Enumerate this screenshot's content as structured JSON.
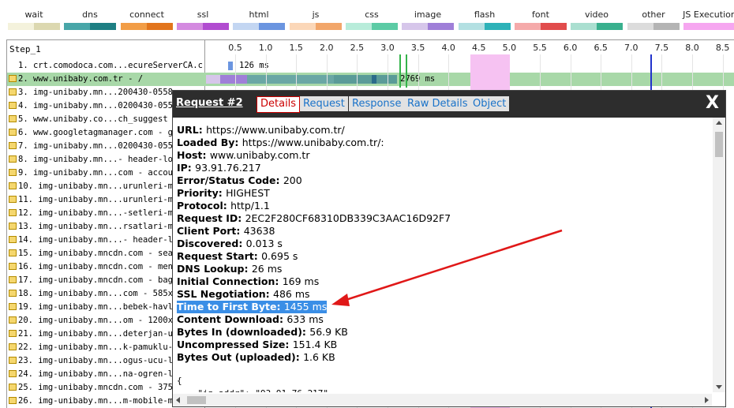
{
  "legend": [
    {
      "label": "wait",
      "colors": [
        "#f4f2dc",
        "#dcd8b0"
      ]
    },
    {
      "label": "dns",
      "colors": [
        "#48a6a8",
        "#1e7f83"
      ]
    },
    {
      "label": "connect",
      "colors": [
        "#f29d46",
        "#e2751c"
      ]
    },
    {
      "label": "ssl",
      "colors": [
        "#d48ae0",
        "#b14cd0"
      ]
    },
    {
      "label": "html",
      "colors": [
        "#c3d6f2",
        "#6b95e0"
      ]
    },
    {
      "label": "js",
      "colors": [
        "#fbd7b8",
        "#f2a66a"
      ]
    },
    {
      "label": "css",
      "colors": [
        "#b8ecda",
        "#5ccba5"
      ]
    },
    {
      "label": "image",
      "colors": [
        "#d6c6ea",
        "#9f7fd8"
      ]
    },
    {
      "label": "flash",
      "colors": [
        "#b3e0e2",
        "#2db2b8"
      ]
    },
    {
      "label": "font",
      "colors": [
        "#f5aaaa",
        "#e14c4c"
      ]
    },
    {
      "label": "video",
      "colors": [
        "#aadfd0",
        "#39b08e"
      ]
    },
    {
      "label": "other",
      "colors": [
        "#dcdcdc",
        "#b4b4b4"
      ]
    },
    {
      "label": "JS Execution",
      "colors": [
        "#f6a6f0",
        "#f6a6f0"
      ]
    }
  ],
  "waterfall": {
    "step_label": "Step_1",
    "ticks": [
      "0.5",
      "1.0",
      "1.5",
      "2.0",
      "2.5",
      "3.0",
      "3.5",
      "4.0",
      "4.5",
      "5.0",
      "5.5",
      "6.0",
      "6.5",
      "7.0",
      "7.5",
      "8.0",
      "8.5"
    ],
    "rows": [
      {
        "label": "1. crt.comodoca.com...ecureServerCA.crt",
        "secure": false,
        "highlight": false,
        "timing": "126 ms"
      },
      {
        "label": "2. www.unibaby.com.tr - /",
        "secure": true,
        "highlight": true,
        "timing": "2769 ms"
      },
      {
        "label": "3. img-unibaby.mn...200430-0558",
        "secure": true,
        "highlight": false,
        "timing": ""
      },
      {
        "label": "4. img-unibaby.mn...0200430-055",
        "secure": true,
        "highlight": false,
        "timing": ""
      },
      {
        "label": "5. www.unibaby.co...ch_suggest",
        "secure": true,
        "highlight": false,
        "timing": ""
      },
      {
        "label": "6. www.googletagmanager.com - g",
        "secure": true,
        "highlight": false,
        "timing": ""
      },
      {
        "label": "7. img-unibaby.mn...0200430-055",
        "secure": true,
        "highlight": false,
        "timing": ""
      },
      {
        "label": "8. img-unibaby.mn...- header-lo",
        "secure": true,
        "highlight": false,
        "timing": ""
      },
      {
        "label": "9. img-unibaby.mn...com - accou",
        "secure": true,
        "highlight": false,
        "timing": ""
      },
      {
        "label": "10. img-unibaby.mn...urunleri-me",
        "secure": true,
        "highlight": false,
        "timing": ""
      },
      {
        "label": "11. img-unibaby.mn...urunleri-me",
        "secure": true,
        "highlight": false,
        "timing": ""
      },
      {
        "label": "12. img-unibaby.mn...-setleri-me",
        "secure": true,
        "highlight": false,
        "timing": ""
      },
      {
        "label": "13. img-unibaby.mn...rsatlari-me",
        "secure": true,
        "highlight": false,
        "timing": ""
      },
      {
        "label": "14. img-unibaby.mn...- header-lo",
        "secure": true,
        "highlight": false,
        "timing": ""
      },
      {
        "label": "15. img-unibaby.mncdn.com - sear",
        "secure": true,
        "highlight": false,
        "timing": ""
      },
      {
        "label": "16. img-unibaby.mncdn.com - menu",
        "secure": true,
        "highlight": false,
        "timing": ""
      },
      {
        "label": "17. img-unibaby.mncdn.com - bag.",
        "secure": true,
        "highlight": false,
        "timing": ""
      },
      {
        "label": "18. img-unibaby.mn...com - 585x5",
        "secure": true,
        "highlight": false,
        "timing": ""
      },
      {
        "label": "19. img-unibaby.mn...bebek-havlu",
        "secure": true,
        "highlight": false,
        "timing": ""
      },
      {
        "label": "20. img-unibaby.mn...om - 1200x5",
        "secure": true,
        "highlight": false,
        "timing": ""
      },
      {
        "label": "21. img-unibaby.mn...deterjan-ur",
        "secure": true,
        "highlight": false,
        "timing": ""
      },
      {
        "label": "22. img-unibaby.mn...k-pamuklu-3",
        "secure": true,
        "highlight": false,
        "timing": ""
      },
      {
        "label": "23. img-unibaby.mn...ogus-ucu-li",
        "secure": true,
        "highlight": false,
        "timing": ""
      },
      {
        "label": "24. img-unibaby.mn...na-ogren-li",
        "secure": true,
        "highlight": false,
        "timing": ""
      },
      {
        "label": "25. img-unibaby.mncdn.com - 375x5",
        "secure": true,
        "highlight": false,
        "timing": ""
      },
      {
        "label": "26. img-unibaby.mn...m-mobile-me",
        "secure": true,
        "highlight": false,
        "timing": ""
      }
    ]
  },
  "dialog": {
    "title": "Request #2",
    "tabs": [
      "Details",
      "Request",
      "Response",
      "Raw Details",
      "Object"
    ],
    "active_tab": "Details",
    "close_label": "X",
    "fields": [
      {
        "key": "URL:",
        "value": "https://www.unibaby.com.tr/"
      },
      {
        "key": "Loaded By:",
        "value": "https://www.unibaby.com.tr/:"
      },
      {
        "key": "Host:",
        "value": "www.unibaby.com.tr"
      },
      {
        "key": "IP:",
        "value": "93.91.76.217"
      },
      {
        "key": "Error/Status Code:",
        "value": "200"
      },
      {
        "key": "Priority:",
        "value": "HIGHEST"
      },
      {
        "key": "Protocol:",
        "value": "http/1.1"
      },
      {
        "key": "Request ID:",
        "value": "2EC2F280CF68310DB339C3AAC16D92F7"
      },
      {
        "key": "Client Port:",
        "value": "43638"
      },
      {
        "key": "Discovered:",
        "value": "0.013 s"
      },
      {
        "key": "Request Start:",
        "value": "0.695 s"
      },
      {
        "key": "DNS Lookup:",
        "value": "26 ms"
      },
      {
        "key": "Initial Connection:",
        "value": "169 ms"
      },
      {
        "key": "SSL Negotiation:",
        "value": "486 ms"
      },
      {
        "key": "Time to First Byte:",
        "value": "1455 ms",
        "selected": true
      },
      {
        "key": "Content Download:",
        "value": "633 ms"
      },
      {
        "key": "Bytes In (downloaded):",
        "value": "56.9 KB"
      },
      {
        "key": "Uncompressed Size:",
        "value": "151.4 KB"
      },
      {
        "key": "Bytes Out (uploaded):",
        "value": "1.6 KB"
      }
    ],
    "json_lines": [
      "{",
      "    \"ip_addr\": \"93.91.76.217\","
    ]
  },
  "annotation": {
    "arrow_color": "#e01818"
  }
}
